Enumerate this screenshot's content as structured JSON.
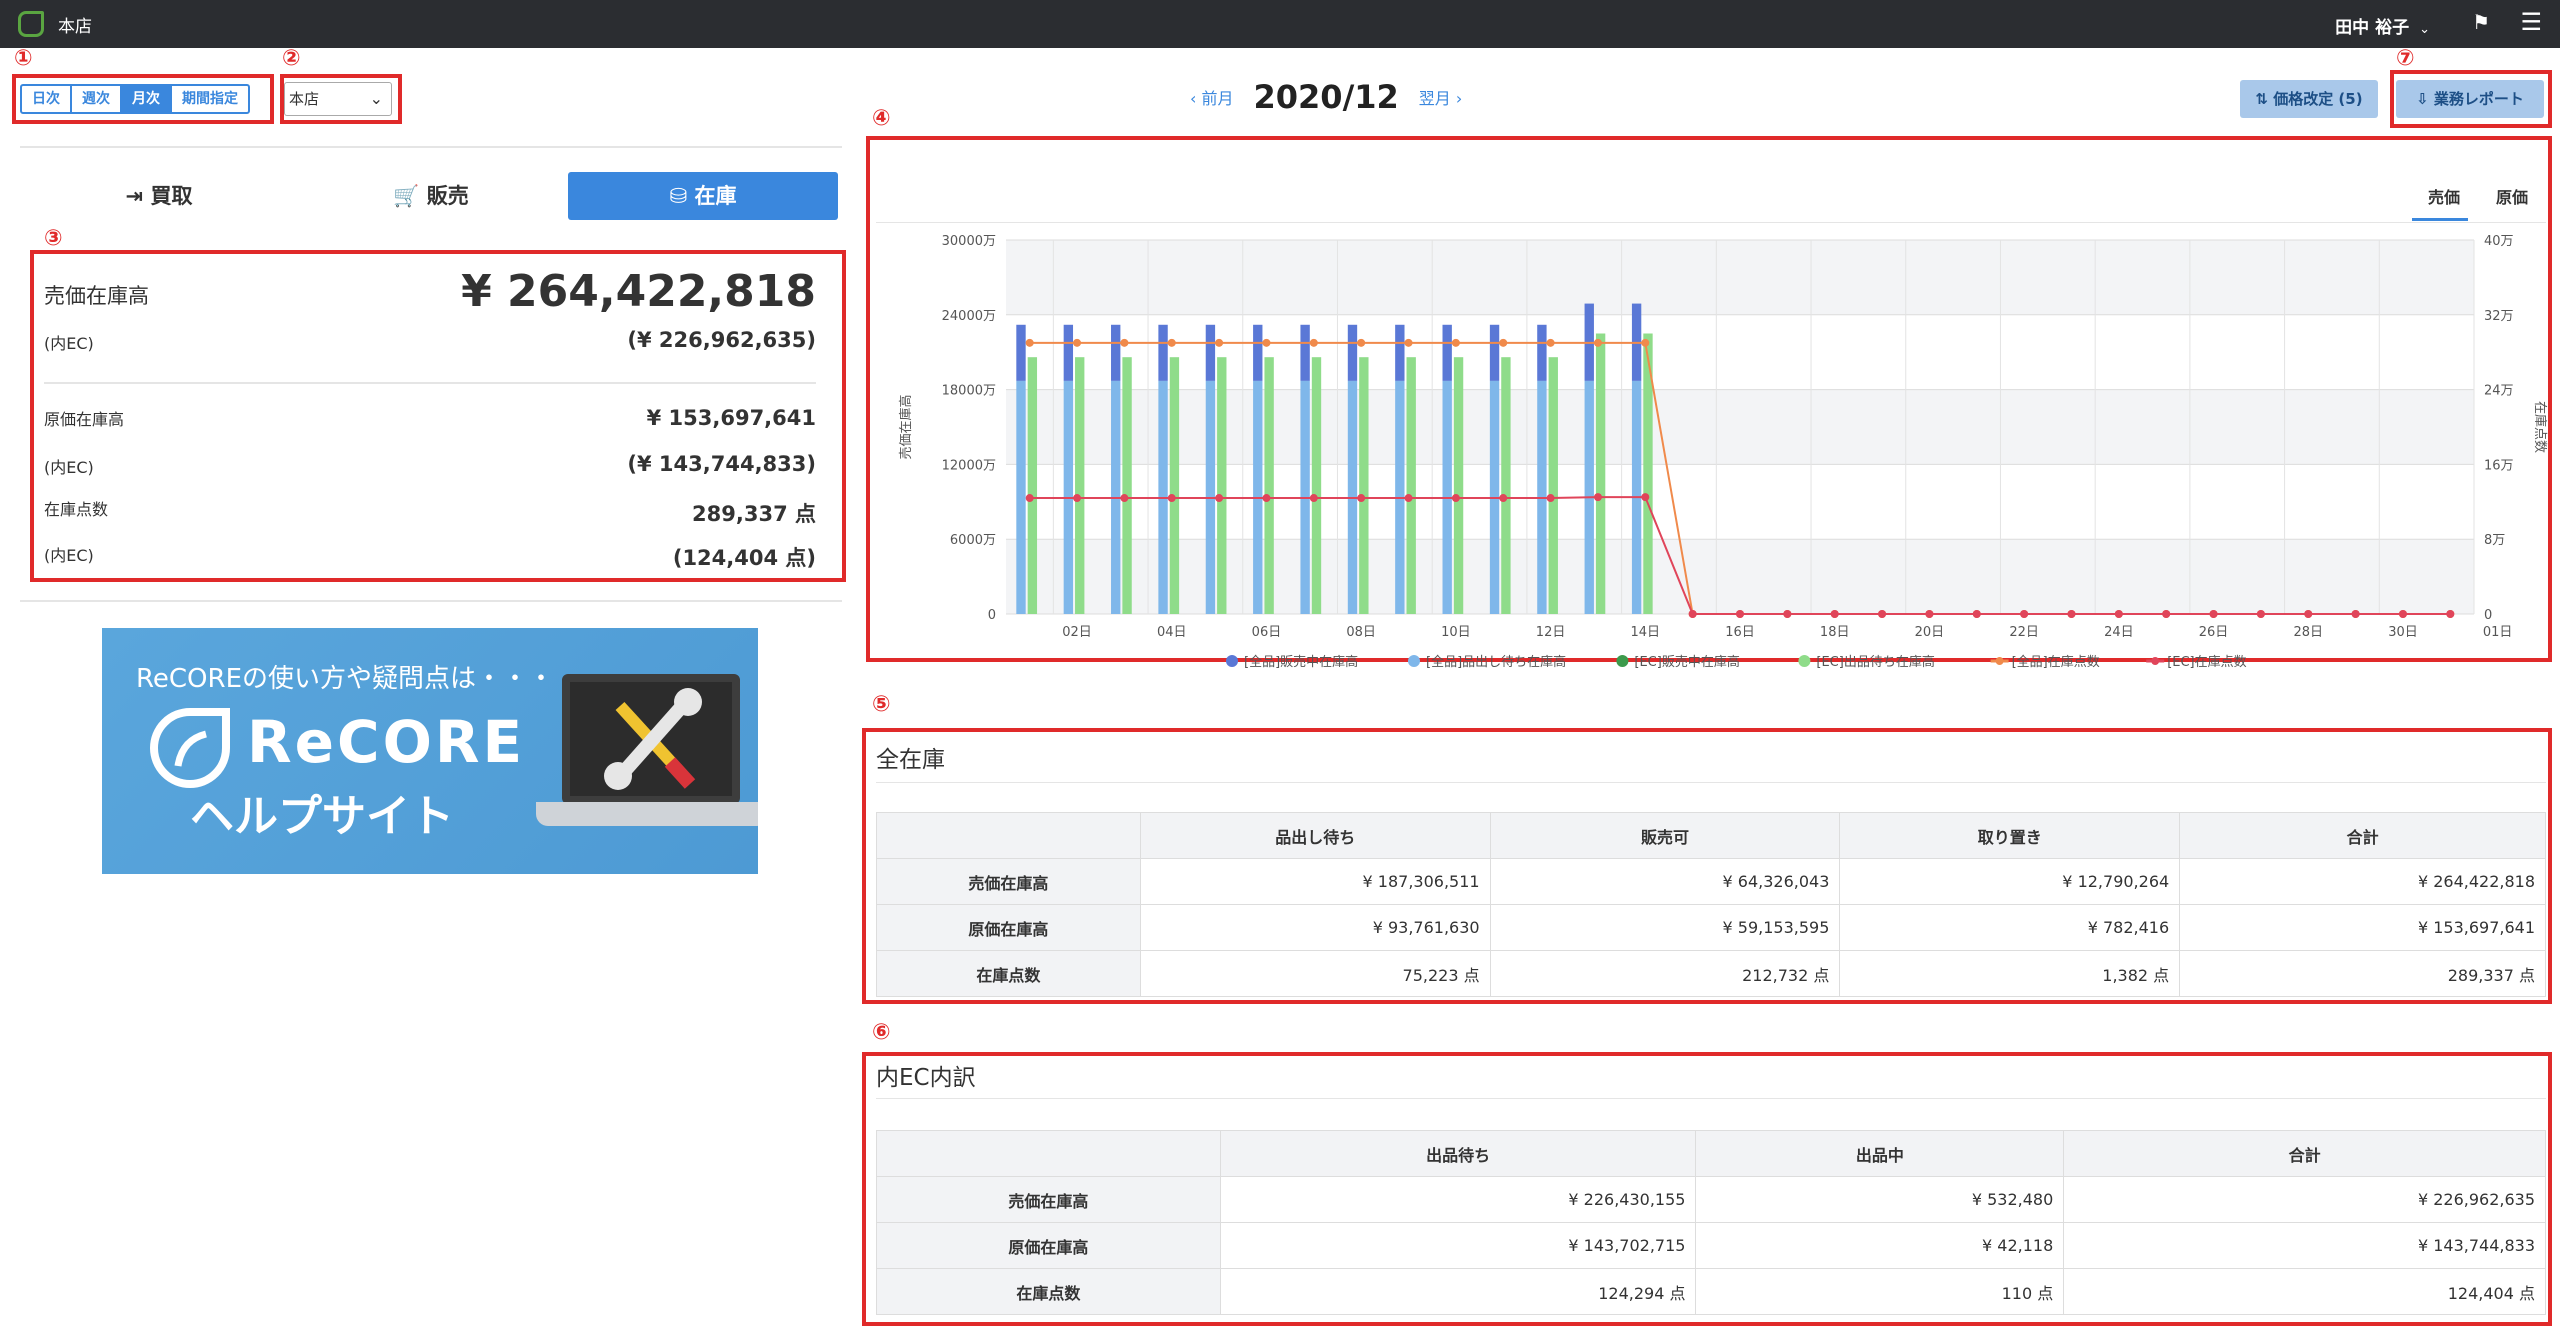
{
  "topbar": {
    "store": "本店",
    "user": "田中 裕子",
    "user_chevron": "⌄",
    "flag_icon": "⚑",
    "menu_icon": "☰"
  },
  "markers": [
    "①",
    "②",
    "③",
    "④",
    "⑤",
    "⑥",
    "⑦"
  ],
  "period_buttons": [
    {
      "label": "日次",
      "active": false
    },
    {
      "label": "週次",
      "active": false
    },
    {
      "label": "月次",
      "active": true
    },
    {
      "label": "期間指定",
      "active": false
    }
  ],
  "store_select": {
    "value": "本店"
  },
  "month_nav": {
    "prev": "‹ 前月",
    "current": "2020/12",
    "next": "翌月 ›"
  },
  "actions": {
    "price_change": "⇅ 価格改定 (5)",
    "report": "⇩ 業務レポート"
  },
  "tabs": [
    {
      "label": "⇥ 買取",
      "active": false
    },
    {
      "label": "🛒 販売",
      "active": false
    },
    {
      "label": "⛁ 在庫",
      "active": true
    }
  ],
  "summary": {
    "sales_label": "売価在庫高",
    "sales_value": "¥ 264,422,818",
    "sales_ec_label": "(内EC)",
    "sales_ec_value": "(¥ 226,962,635)",
    "cost_label": "原価在庫高",
    "cost_value": "¥ 153,697,641",
    "cost_ec_label": "(内EC)",
    "cost_ec_value": "(¥ 143,744,833)",
    "count_label": "在庫点数",
    "count_value": "289,337 点",
    "count_ec_label": "(内EC)",
    "count_ec_value": "(124,404 点)"
  },
  "banner": {
    "line1": "ReCOREの使い方や疑問点は・・・",
    "line2": "ReCORE",
    "line3": "ヘルプサイト"
  },
  "chart_tabs": [
    {
      "label": "売価",
      "active": true
    },
    {
      "label": "原価",
      "active": false
    }
  ],
  "chart_data": {
    "type": "bar",
    "ylabel": "売価在庫高",
    "y2label": "在庫点数",
    "ylim": [
      0,
      30000
    ],
    "y2lim": [
      0,
      40
    ],
    "y_ticks": [
      "0",
      "6000万",
      "12000万",
      "18000万",
      "24000万",
      "30000万"
    ],
    "y2_ticks": [
      "0",
      "8万",
      "16万",
      "24万",
      "32万",
      "40万"
    ],
    "x_ticks": [
      "02日",
      "04日",
      "06日",
      "08日",
      "10日",
      "12日",
      "14日",
      "16日",
      "18日",
      "20日",
      "22日",
      "24日",
      "26日",
      "28日",
      "30日",
      "01日"
    ],
    "days": 31,
    "series": [
      {
        "name": "[全品]販売中在庫高",
        "kind": "bar",
        "stack": "all",
        "color": "#5a78d6",
        "values": [
          4500,
          4500,
          4500,
          4500,
          4500,
          4500,
          4500,
          4500,
          4500,
          4500,
          4500,
          4500,
          6200,
          6200,
          0,
          0,
          0,
          0,
          0,
          0,
          0,
          0,
          0,
          0,
          0,
          0,
          0,
          0,
          0,
          0,
          0
        ]
      },
      {
        "name": "[全品]品出し待ち在庫高",
        "kind": "bar",
        "stack": "all",
        "color": "#7fb7ea",
        "values": [
          18700,
          18700,
          18700,
          18700,
          18700,
          18700,
          18700,
          18700,
          18700,
          18700,
          18700,
          18700,
          18700,
          18700,
          0,
          0,
          0,
          0,
          0,
          0,
          0,
          0,
          0,
          0,
          0,
          0,
          0,
          0,
          0,
          0,
          0
        ]
      },
      {
        "name": "[EC]販売中在庫高",
        "kind": "bar",
        "stack": "ec",
        "color": "#3c9a4c",
        "values": [
          0,
          0,
          0,
          0,
          0,
          0,
          0,
          0,
          0,
          0,
          0,
          0,
          0,
          0,
          0,
          0,
          0,
          0,
          0,
          0,
          0,
          0,
          0,
          0,
          0,
          0,
          0,
          0,
          0,
          0,
          0
        ]
      },
      {
        "name": "[EC]出品待ち在庫高",
        "kind": "bar",
        "stack": "ec",
        "color": "#8fdc8a",
        "values": [
          20600,
          20600,
          20600,
          20600,
          20600,
          20600,
          20600,
          20600,
          20600,
          20600,
          20600,
          20600,
          22500,
          22500,
          0,
          0,
          0,
          0,
          0,
          0,
          0,
          0,
          0,
          0,
          0,
          0,
          0,
          0,
          0,
          0,
          0
        ]
      },
      {
        "name": "[全品]在庫点数",
        "kind": "line",
        "axis": "y2",
        "color": "#f08a4b",
        "values": [
          29,
          29,
          29,
          29,
          29,
          29,
          29,
          29,
          29,
          29,
          29,
          29,
          29,
          29,
          0,
          0,
          0,
          0,
          0,
          0,
          0,
          0,
          0,
          0,
          0,
          0,
          0,
          0,
          0,
          0,
          0
        ]
      },
      {
        "name": "[EC]在庫点数",
        "kind": "line",
        "axis": "y2",
        "color": "#e0455a",
        "values": [
          12.4,
          12.4,
          12.4,
          12.4,
          12.4,
          12.4,
          12.4,
          12.4,
          12.4,
          12.4,
          12.4,
          12.4,
          12.5,
          12.5,
          0,
          0,
          0,
          0,
          0,
          0,
          0,
          0,
          0,
          0,
          0,
          0,
          0,
          0,
          0,
          0,
          0
        ]
      }
    ]
  },
  "all_stock": {
    "title": "全在庫",
    "headers": [
      "",
      "品出し待ち",
      "販売可",
      "取り置き",
      "合計"
    ],
    "rows": [
      [
        "売価在庫高",
        "¥ 187,306,511",
        "¥ 64,326,043",
        "¥ 12,790,264",
        "¥ 264,422,818"
      ],
      [
        "原価在庫高",
        "¥ 93,761,630",
        "¥ 59,153,595",
        "¥ 782,416",
        "¥ 153,697,641"
      ],
      [
        "在庫点数",
        "75,223 点",
        "212,732 点",
        "1,382 点",
        "289,337 点"
      ]
    ]
  },
  "ec_stock": {
    "title": "内EC内訳",
    "headers": [
      "",
      "出品待ち",
      "出品中",
      "合計"
    ],
    "rows": [
      [
        "売価在庫高",
        "¥ 226,430,155",
        "¥ 532,480",
        "¥ 226,962,635"
      ],
      [
        "原価在庫高",
        "¥ 143,702,715",
        "¥ 42,118",
        "¥ 143,744,833"
      ],
      [
        "在庫点数",
        "124,294 点",
        "110 点",
        "124,404 点"
      ]
    ]
  }
}
